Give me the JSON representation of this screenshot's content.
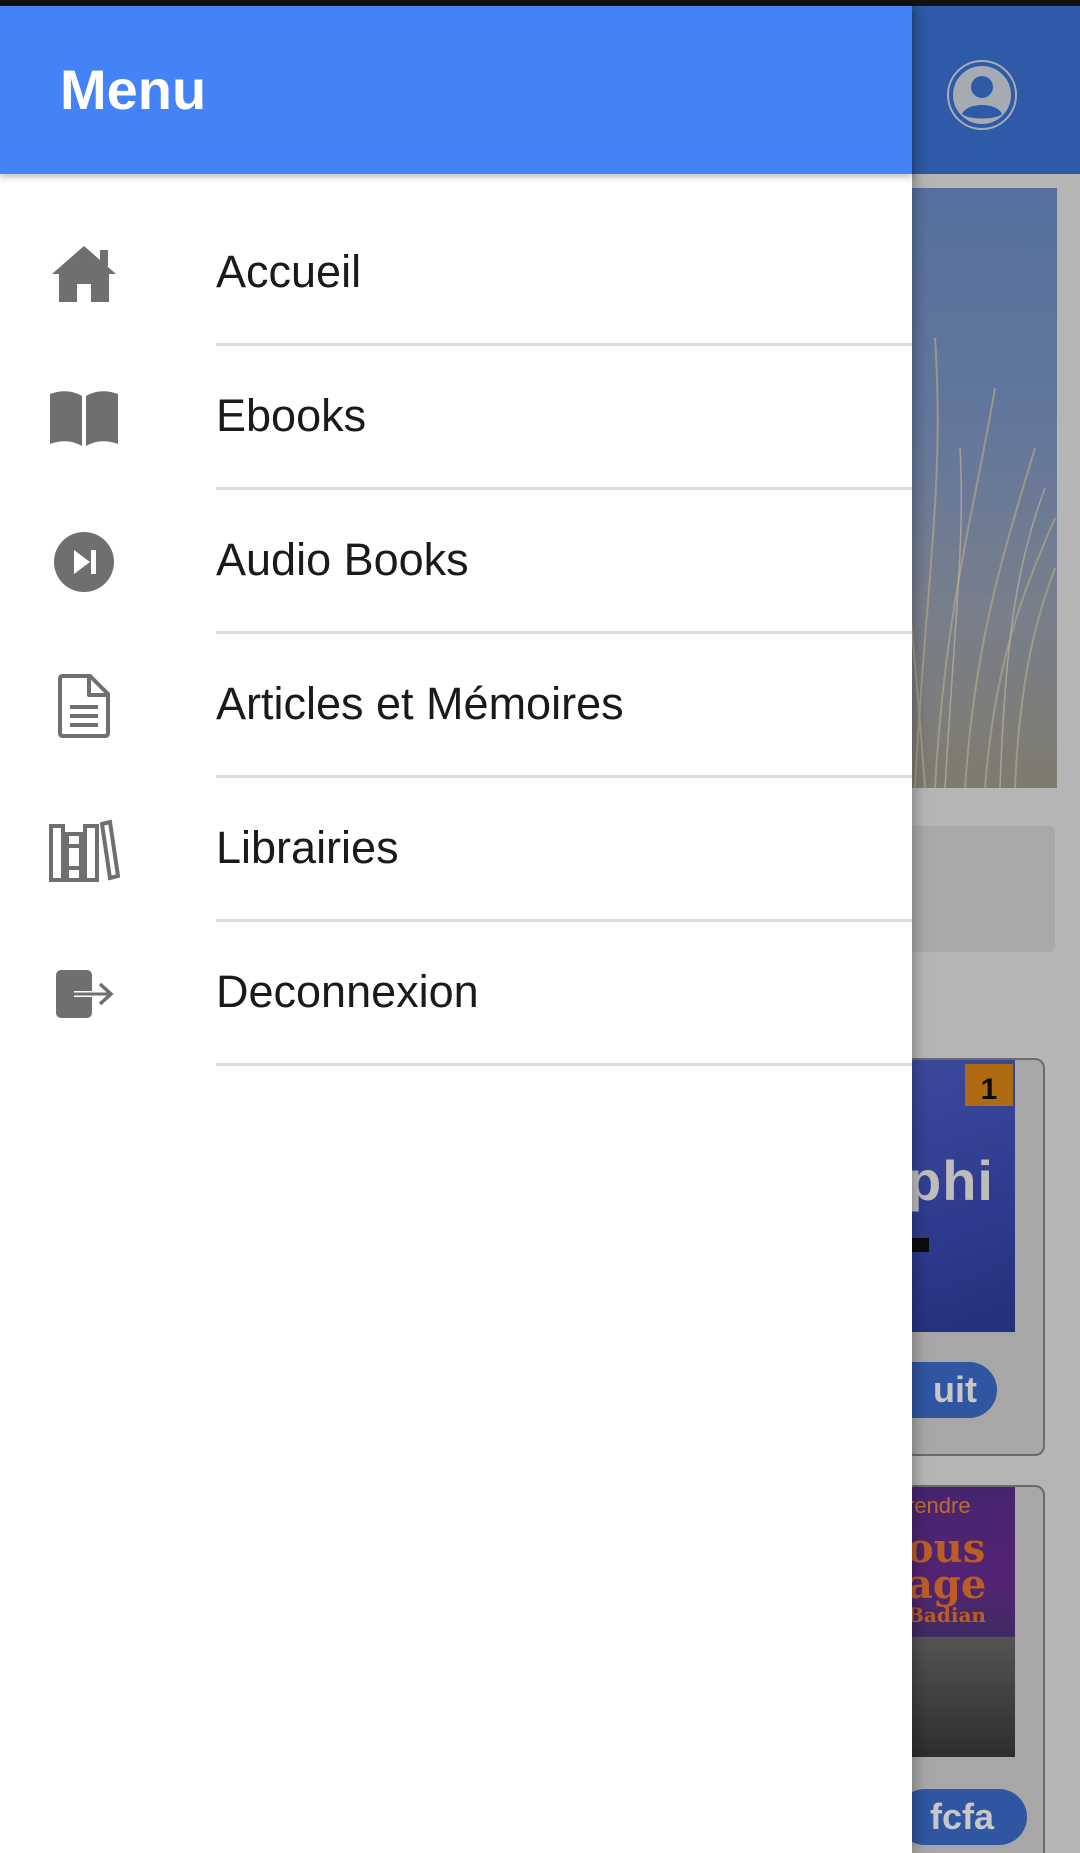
{
  "drawer": {
    "title": "Menu",
    "items": [
      {
        "label": "Accueil",
        "icon": "home-icon"
      },
      {
        "label": "Ebooks",
        "icon": "book-open-icon"
      },
      {
        "label": "Audio Books",
        "icon": "skip-next-circle-icon"
      },
      {
        "label": "Articles et Mémoires",
        "icon": "document-icon"
      },
      {
        "label": "Librairies",
        "icon": "library-books-icon"
      },
      {
        "label": "Deconnexion",
        "icon": "logout-icon"
      }
    ]
  },
  "background": {
    "book1": {
      "cover_text": "phi",
      "badge": "1",
      "price_text": "uit"
    },
    "book2": {
      "cover_line1": "rendre",
      "cover_line2": "ous",
      "cover_line3": "age",
      "cover_line4": "Badian",
      "price_text": "fcfa"
    }
  },
  "colors": {
    "drawer_header": "#4482f7",
    "app_header": "#3d74d6",
    "icon_gray": "#6f6f6f",
    "text": "#1a1a1a",
    "divider": "#dcdcdc"
  }
}
